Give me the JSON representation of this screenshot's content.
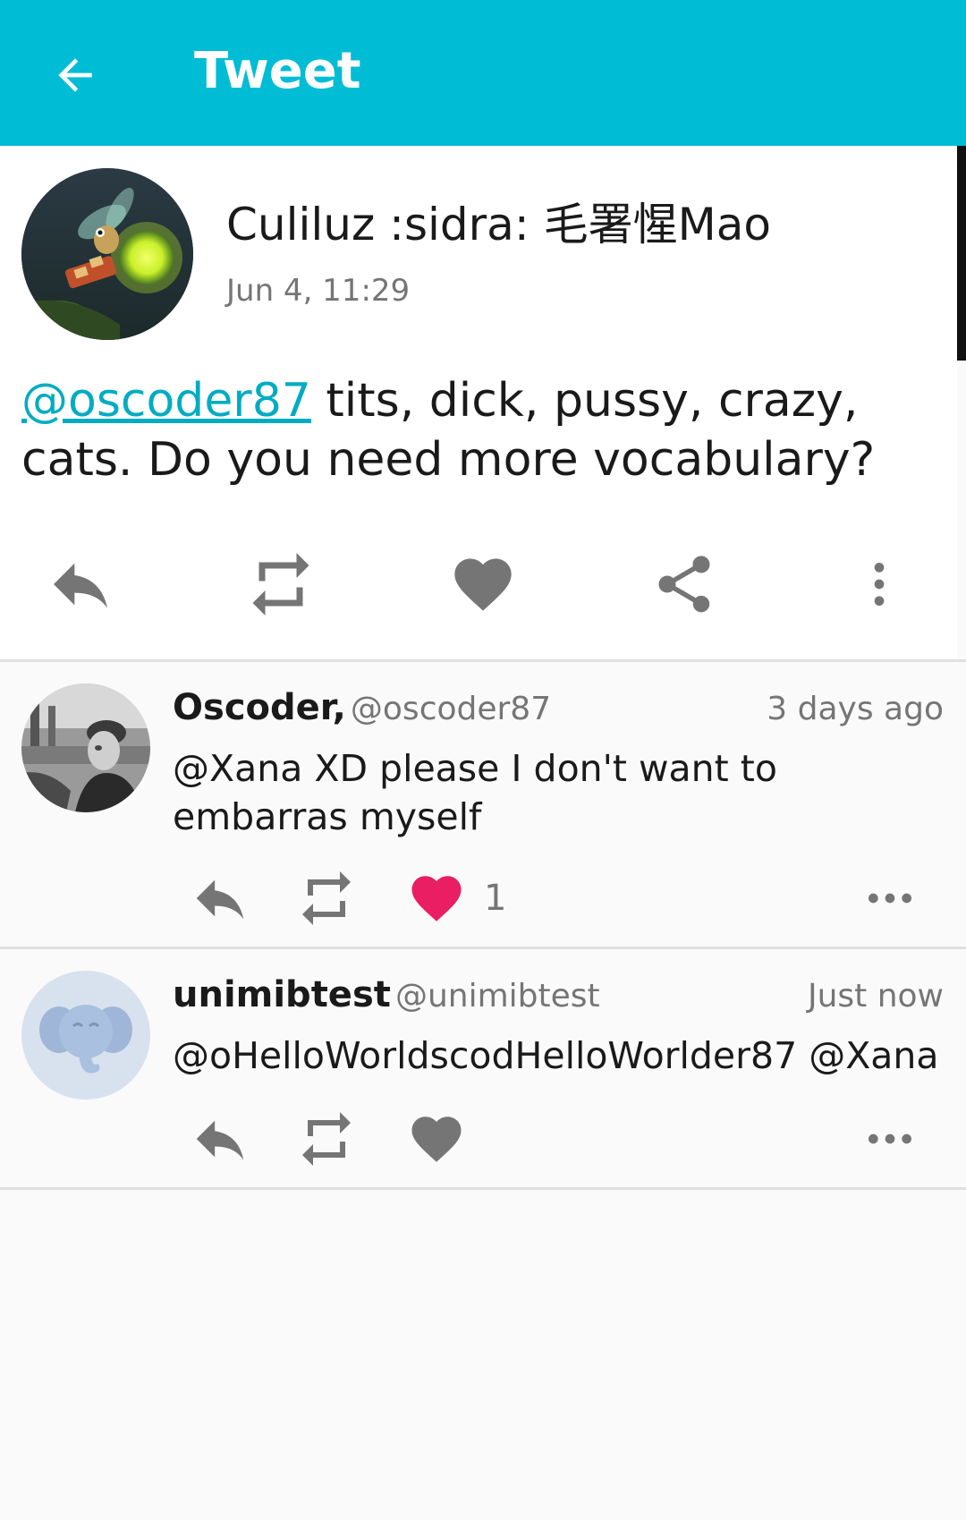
{
  "appbar": {
    "title": "Tweet"
  },
  "main_tweet": {
    "author": "Culiluz :sidra: 毛署惺Mao",
    "date": "Jun 4, 11:29",
    "mention": "@oscoder87",
    "text_rest": " tits, dick, pussy, crazy, cats. Do you need more vocabulary?"
  },
  "replies": [
    {
      "name": "Oscoder,",
      "handle": "@oscoder87",
      "time": "3 days ago",
      "text": "@Xana XD please I don't want to embarras myself",
      "fav_count": "1",
      "favorited": true
    },
    {
      "name": "unimibtest",
      "handle": "@unimibtest",
      "time": "Just now",
      "text": "@oHelloWorldscodHelloWorlder87 @Xana",
      "fav_count": "",
      "favorited": false
    }
  ],
  "colors": {
    "appbar": "#00bcd4",
    "link": "#00acc1",
    "icon_gray": "#757575",
    "favorite_active": "#e91e63",
    "divider": "#e0e0e0"
  },
  "icons": {
    "back": "arrow-left-icon",
    "reply": "reply-icon",
    "retweet": "retweet-icon",
    "favorite": "heart-icon",
    "share": "share-icon",
    "more_vertical": "more-vertical-icon",
    "more_horizontal": "more-horizontal-icon"
  }
}
